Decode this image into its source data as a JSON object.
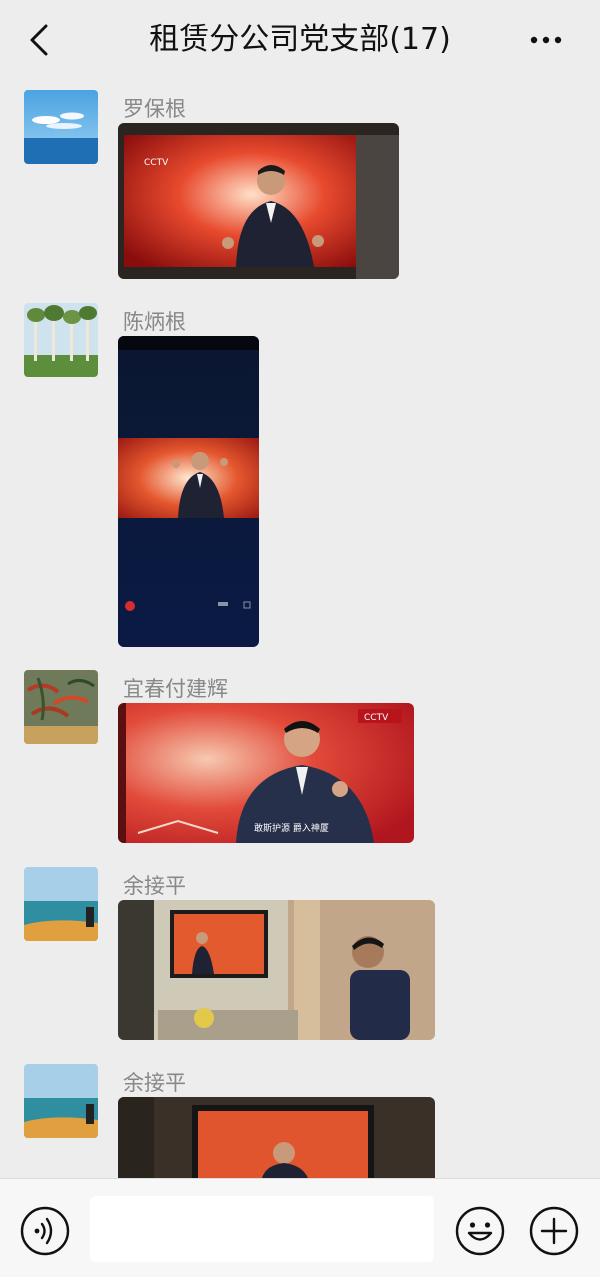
{
  "header": {
    "title": "租赁分公司党支部(17)",
    "back_icon": "chevron-left-icon",
    "more_icon": "more-dots-icon"
  },
  "messages": [
    {
      "sender": "罗保根",
      "avatar": "ocean-clouds-avatar",
      "content": "photo of TV broadcast (CCTV)"
    },
    {
      "sender": "陈炳根",
      "avatar": "tree-park-avatar",
      "content": "phone screenshot of CCTV video"
    },
    {
      "sender": "宜春付建辉",
      "avatar": "painting-avatar",
      "content": "photo of TV broadcast with caption"
    },
    {
      "sender": "余接平",
      "avatar": "seaside-avatar",
      "content": "photo of TV in living room"
    },
    {
      "sender": "余接平",
      "avatar": "seaside-avatar",
      "content": "photo of TV broadcast"
    }
  ],
  "tv_caption": "敢斯护源 爵入神厦",
  "channel_logo": "CCTV",
  "composer": {
    "voice_icon": "voice-icon",
    "input_value": "",
    "emoji_icon": "emoji-icon",
    "plus_icon": "plus-icon"
  },
  "colors": {
    "background": "#ededed",
    "bottom_bar": "#f7f7f7",
    "sender_text": "#888888",
    "title_text": "#111111"
  }
}
